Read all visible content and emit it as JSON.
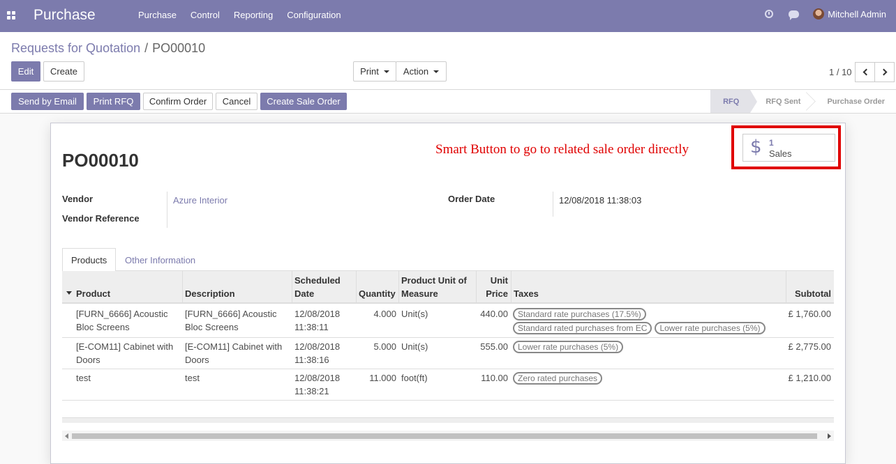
{
  "navbar": {
    "app_title": "Purchase",
    "menu": [
      "Purchase",
      "Control",
      "Reporting",
      "Configuration"
    ],
    "user_name": "Mitchell Admin",
    "icons": [
      "apps-icon",
      "clock-icon",
      "chat-icon",
      "avatar"
    ]
  },
  "breadcrumb": {
    "parent": "Requests for Quotation",
    "separator": "/",
    "current": "PO00010"
  },
  "toolbar": {
    "edit": "Edit",
    "create": "Create",
    "print": "Print",
    "action": "Action",
    "pager": "1 / 10"
  },
  "statusbar": {
    "buttons": [
      "Send by Email",
      "Print RFQ",
      "Confirm Order",
      "Cancel",
      "Create Sale Order"
    ],
    "stages": [
      "RFQ",
      "RFQ Sent",
      "Purchase Order"
    ],
    "active_stage": "RFQ"
  },
  "form": {
    "annotation": "Smart Button to go to related sale order directly",
    "smart_button": {
      "value": "1",
      "label": "Sales",
      "icon": "dollar-icon"
    },
    "title": "PO00010",
    "fields": {
      "vendor_label": "Vendor",
      "vendor_value": "Azure Interior",
      "vendor_ref_label": "Vendor Reference",
      "vendor_ref_value": "",
      "order_date_label": "Order Date",
      "order_date_value": "12/08/2018 11:38:03"
    },
    "tabs": [
      "Products",
      "Other Information"
    ]
  },
  "order_lines": {
    "headers": {
      "product": "Product",
      "description": "Description",
      "scheduled_1": "Scheduled",
      "scheduled_2": "Date",
      "quantity": "Quantity",
      "uom_1": "Product Unit of",
      "uom_2": "Measure",
      "price_1": "Unit",
      "price_2": "Price",
      "taxes": "Taxes",
      "subtotal": "Subtotal"
    },
    "rows": [
      {
        "product_1": "[FURN_6666] Acoustic",
        "product_2": "Bloc Screens",
        "desc_1": "[FURN_6666] Acoustic",
        "desc_2": "Bloc Screens",
        "date_1": "12/08/2018",
        "date_2": "11:38:11",
        "quantity": "4.000",
        "uom": "Unit(s)",
        "price": "440.00",
        "taxes": [
          "Standard rate purchases (17.5%)",
          "Standard rated purchases from EC",
          "Lower rate purchases (5%)"
        ],
        "subtotal": "£ 1,760.00"
      },
      {
        "product_1": "[E-COM11] Cabinet with",
        "product_2": "Doors",
        "desc_1": "[E-COM11] Cabinet with",
        "desc_2": "Doors",
        "date_1": "12/08/2018",
        "date_2": "11:38:16",
        "quantity": "5.000",
        "uom": "Unit(s)",
        "price": "555.00",
        "taxes": [
          "Lower rate purchases (5%)"
        ],
        "subtotal": "£ 2,775.00"
      },
      {
        "product_1": "test",
        "product_2": "",
        "desc_1": "test",
        "desc_2": "",
        "date_1": "12/08/2018",
        "date_2": "11:38:21",
        "quantity": "11.000",
        "uom": "foot(ft)",
        "price": "110.00",
        "taxes": [
          "Zero rated purchases"
        ],
        "subtotal": "£ 1,210.00"
      }
    ]
  },
  "colors": {
    "brand": "#7c7bad",
    "annotation": "#e00000"
  }
}
